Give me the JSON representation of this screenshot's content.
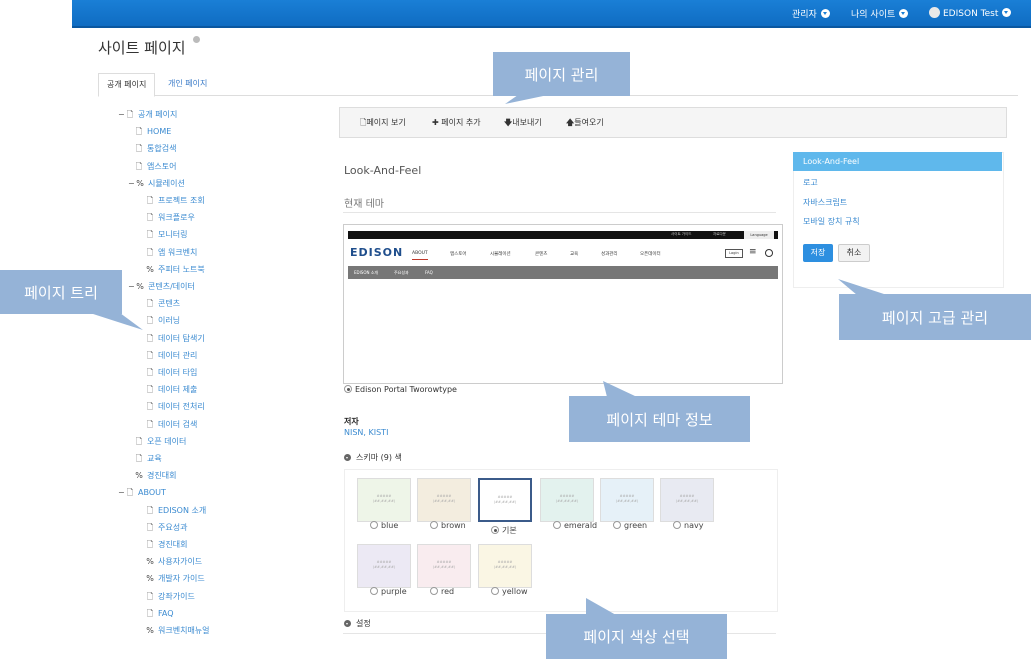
{
  "topbar": {
    "admin": "관리자",
    "my_sites": "나의 사이트",
    "user": "EDISON Test"
  },
  "page": {
    "title": "사이트 페이지"
  },
  "tabs": {
    "public": "공개 페이지",
    "private": "개인 페이지"
  },
  "tree": [
    {
      "label": "공개 페이지",
      "icon": "page",
      "toggle": "−"
    },
    {
      "label": "HOME",
      "icon": "page"
    },
    {
      "label": "통합검색",
      "icon": "page"
    },
    {
      "label": "앱스토어",
      "icon": "page"
    },
    {
      "label": "시뮬레이션",
      "icon": "link",
      "toggle": "−"
    },
    {
      "label": "프로젝트 조회",
      "icon": "page"
    },
    {
      "label": "워크플로우",
      "icon": "page"
    },
    {
      "label": "모니터링",
      "icon": "page"
    },
    {
      "label": "앱 워크벤치",
      "icon": "page"
    },
    {
      "label": "주피터 노트북",
      "icon": "link"
    },
    {
      "label": "콘텐츠/데이터",
      "icon": "link",
      "toggle": "−"
    },
    {
      "label": "콘텐츠",
      "icon": "page"
    },
    {
      "label": "이러닝",
      "icon": "page"
    },
    {
      "label": "데이터 탐색기",
      "icon": "page"
    },
    {
      "label": "데이터 관리",
      "icon": "page"
    },
    {
      "label": "데이터 타입",
      "icon": "page"
    },
    {
      "label": "데이터 제출",
      "icon": "page"
    },
    {
      "label": "데이터 전처리",
      "icon": "page"
    },
    {
      "label": "데이터 검색",
      "icon": "page"
    },
    {
      "label": "오픈 데이터",
      "icon": "page"
    },
    {
      "label": "교육",
      "icon": "page"
    },
    {
      "label": "경진대회",
      "icon": "link"
    },
    {
      "label": "ABOUT",
      "icon": "page",
      "toggle": "−"
    },
    {
      "label": "EDISON 소개",
      "icon": "page"
    },
    {
      "label": "주요성과",
      "icon": "page"
    },
    {
      "label": "경진대회",
      "icon": "page"
    },
    {
      "label": "사용자가이드",
      "icon": "link"
    },
    {
      "label": "개발자 가이드",
      "icon": "link"
    },
    {
      "label": "강좌가이드",
      "icon": "page"
    },
    {
      "label": "FAQ",
      "icon": "page"
    },
    {
      "label": "워크벤치매뉴얼",
      "icon": "link"
    }
  ],
  "toolbar": {
    "view": "페이지 보기",
    "add": "페이지 추가",
    "export": "내보내기",
    "import": "들여오기"
  },
  "main": {
    "look_title": "Look-And-Feel",
    "current_theme": "현재 테마",
    "theme_name": "Edison Portal Tworowtype",
    "author_label": "저자",
    "author_value": "NISN, KISTI",
    "scheme_head": "스키마 (9) 색",
    "settings_head": "설정"
  },
  "preview": {
    "util": [
      "사이트 가이드",
      "자료다운",
      "Language"
    ],
    "logo": "EDISON",
    "nav": [
      "ABOUT",
      "앱스토어",
      "시뮬레이션",
      "콘텐츠",
      "교육",
      "성과관리",
      "오픈데이터"
    ],
    "login": "Login",
    "subnav": [
      "EDISON 소개",
      "주요성과",
      "FAQ"
    ]
  },
  "swatches": [
    {
      "label": "blue",
      "color": "#eef5e8",
      "selected": false
    },
    {
      "label": "brown",
      "color": "#f3eddf",
      "selected": false
    },
    {
      "label": "기본",
      "color": "#ffffff",
      "selected": true
    },
    {
      "label": "emerald",
      "color": "#e3f2ee",
      "selected": false
    },
    {
      "label": "green",
      "color": "#e6f1f8",
      "selected": false
    },
    {
      "label": "navy",
      "color": "#e8eaf2",
      "selected": false
    },
    {
      "label": "purple",
      "color": "#ece9f4",
      "selected": false
    },
    {
      "label": "red",
      "color": "#f9ecef",
      "selected": false
    },
    {
      "label": "yellow",
      "color": "#faf6e4",
      "selected": false
    }
  ],
  "swatch_text": "#####\n(##,##,##)",
  "right_panel": {
    "items": [
      "Look-And-Feel",
      "로고",
      "자바스크립트",
      "모바일 장치 규칙"
    ],
    "save": "저장",
    "cancel": "취소"
  },
  "callouts": {
    "page_manage": "페이지 관리",
    "page_tree": "페이지 트리",
    "advanced": "페이지 고급 관리",
    "theme_info": "페이지 테마 정보",
    "color_select": "페이지 색상 선택"
  },
  "colors": {
    "topbar": "#1a7fd6",
    "accent": "#5fb8ec",
    "callout": "#95b3d7",
    "link": "#3a8ad0"
  }
}
